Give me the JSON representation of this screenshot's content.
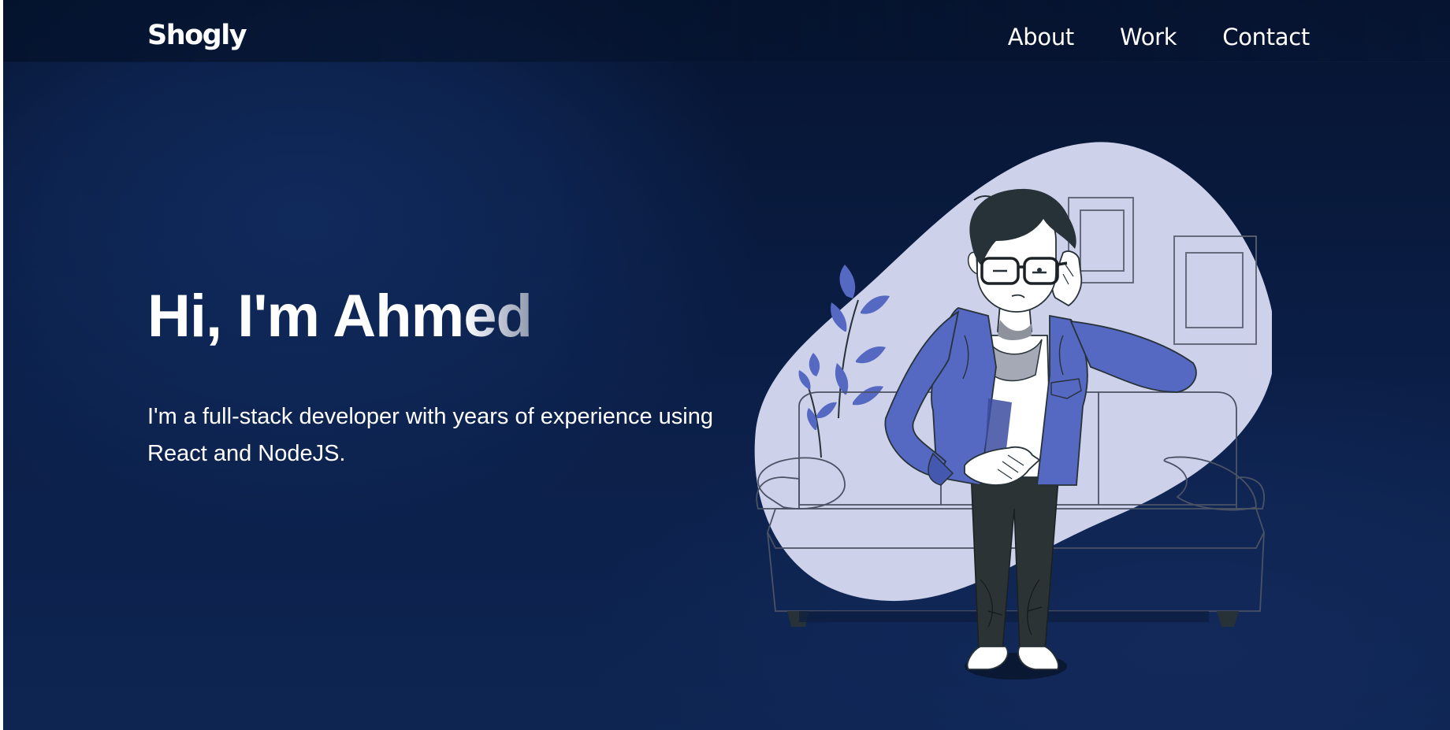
{
  "brand": {
    "logo_text": "Shogly"
  },
  "nav": {
    "items": [
      {
        "label": "About"
      },
      {
        "label": "Work"
      },
      {
        "label": "Contact"
      }
    ]
  },
  "hero": {
    "title_main": "Hi, I'm Ahm",
    "title_fade": "ed",
    "subtitle": "I'm a full-stack developer with years of experience using React and NodeJS."
  },
  "colors": {
    "background_dark": "#061431",
    "background_mid": "#102a5c",
    "blob": "#cdd1ea",
    "jacket": "#5568c2",
    "ink": "#263238"
  },
  "icons": {
    "illustration": "developer-with-glasses-illustration"
  }
}
